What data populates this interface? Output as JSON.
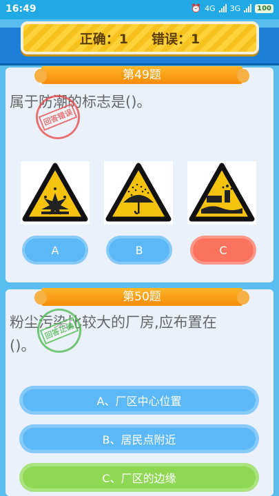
{
  "status_bar": {
    "time": "16:49",
    "network1": "4G",
    "network2": "3G",
    "battery": "100"
  },
  "score": {
    "correct_label": "正确：1",
    "wrong_label": "错误：1"
  },
  "questions": [
    {
      "title": "第49题",
      "text": "属于防潮的标志是()。",
      "stamp": "回答错误",
      "options": [
        "A",
        "B",
        "C"
      ],
      "colors": {
        "A": "#5cb8f7",
        "B": "#5cb8f7",
        "C": "#fb735e"
      }
    },
    {
      "title": "第50题",
      "text_line1": "粉尘污染比较大的厂房,应布置在",
      "text_line2": "()。",
      "stamp": "回答正确",
      "options": [
        "A、厂区中心位置",
        "B、居民点附近",
        "C、厂区的边缘"
      ],
      "colors": {
        "A": "#5cb8f7",
        "B": "#5cb8f7",
        "C": "#8ed853"
      }
    }
  ]
}
